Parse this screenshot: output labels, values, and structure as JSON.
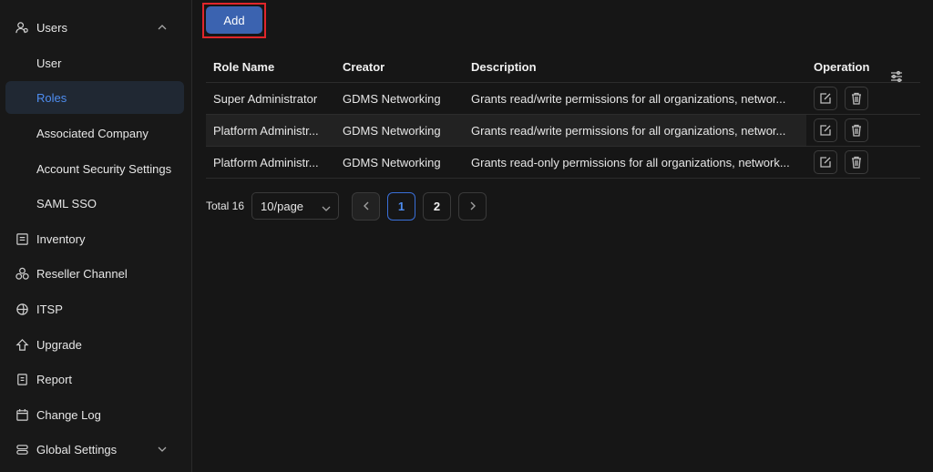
{
  "sidebar": {
    "items": [
      {
        "label": "Users",
        "icon": "users-icon"
      },
      {
        "label": "User"
      },
      {
        "label": "Roles"
      },
      {
        "label": "Associated Company"
      },
      {
        "label": "Account Security Settings"
      },
      {
        "label": "SAML SSO"
      },
      {
        "label": "Inventory",
        "icon": "inventory-icon"
      },
      {
        "label": "Reseller Channel",
        "icon": "reseller-icon"
      },
      {
        "label": "ITSP",
        "icon": "itsp-icon"
      },
      {
        "label": "Upgrade",
        "icon": "upgrade-icon"
      },
      {
        "label": "Report",
        "icon": "report-icon"
      },
      {
        "label": "Change Log",
        "icon": "changelog-icon"
      },
      {
        "label": "Global Settings",
        "icon": "global-settings-icon"
      }
    ]
  },
  "toolbar": {
    "add_label": "Add"
  },
  "table": {
    "headers": [
      "Role Name",
      "Creator",
      "Description",
      "Operation"
    ],
    "rows": [
      {
        "role": "Super Administrator",
        "creator": "GDMS Networking",
        "description": "Grants read/write permissions for all organizations, networ..."
      },
      {
        "role": "Platform Administr...",
        "creator": "GDMS Networking",
        "description": "Grants read/write permissions for all organizations, networ..."
      },
      {
        "role": "Platform Administr...",
        "creator": "GDMS Networking",
        "description": "Grants read-only permissions for all organizations, network..."
      }
    ]
  },
  "pagination": {
    "total": "Total 16",
    "page_size": "10/page",
    "pages": [
      "1",
      "2"
    ],
    "current": "1"
  },
  "colors": {
    "accent": "#4e8df0",
    "button": "#3b63b0",
    "highlight": "#e0262b"
  }
}
